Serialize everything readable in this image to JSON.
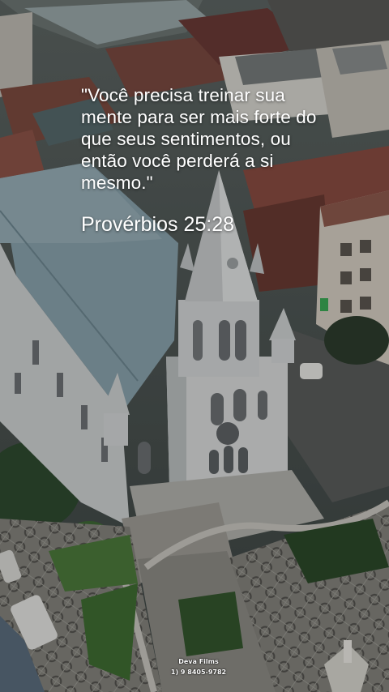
{
  "quote": {
    "text": "\"Você precisa treinar sua mente para ser mais forte do que seus sentimentos, ou então você perderá a si mesmo.\"",
    "reference": "Provérbios 25:28"
  },
  "watermark": {
    "name": "Deva Films",
    "phone": "1) 9 8405-9782"
  },
  "colors": {
    "text": "#ffffff",
    "roof": "#8aa3ad",
    "church_wall": "#dadcdc",
    "plaza": "#8e8c86",
    "tile_roofs": "#7a4a40"
  }
}
